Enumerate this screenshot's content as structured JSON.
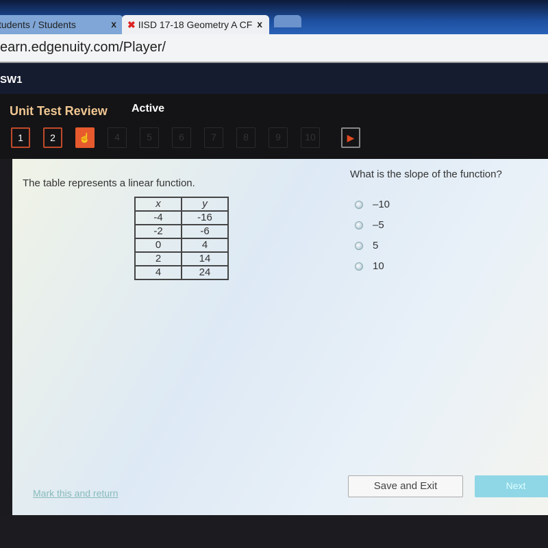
{
  "browser": {
    "tabs": [
      {
        "label": "tudents / Students",
        "close": "x"
      },
      {
        "label": "IISD 17-18 Geometry A CF",
        "close": "x",
        "active": true
      }
    ],
    "url": "earn.edgenuity.com/Player/"
  },
  "header": {
    "course": "SW1"
  },
  "activity": {
    "title": "Unit Test Review",
    "status": "Active",
    "questions": [
      "1",
      "2",
      "3",
      "4",
      "5",
      "6",
      "7",
      "8",
      "9",
      "10"
    ],
    "current": 3
  },
  "question": {
    "stem": "The table represents a linear function.",
    "prompt": "What is the slope of the function?",
    "table": {
      "headers": [
        "x",
        "y"
      ],
      "rows": [
        [
          "-4",
          "-16"
        ],
        [
          "-2",
          "-6"
        ],
        [
          "0",
          "4"
        ],
        [
          "2",
          "14"
        ],
        [
          "4",
          "24"
        ]
      ]
    },
    "options": [
      "–10",
      "–5",
      "5",
      "10"
    ]
  },
  "footer": {
    "mark": "Mark this and return",
    "save": "Save and Exit",
    "next": "Next"
  },
  "colors": {
    "accent": "#e65a2e",
    "title": "#f1c792"
  }
}
